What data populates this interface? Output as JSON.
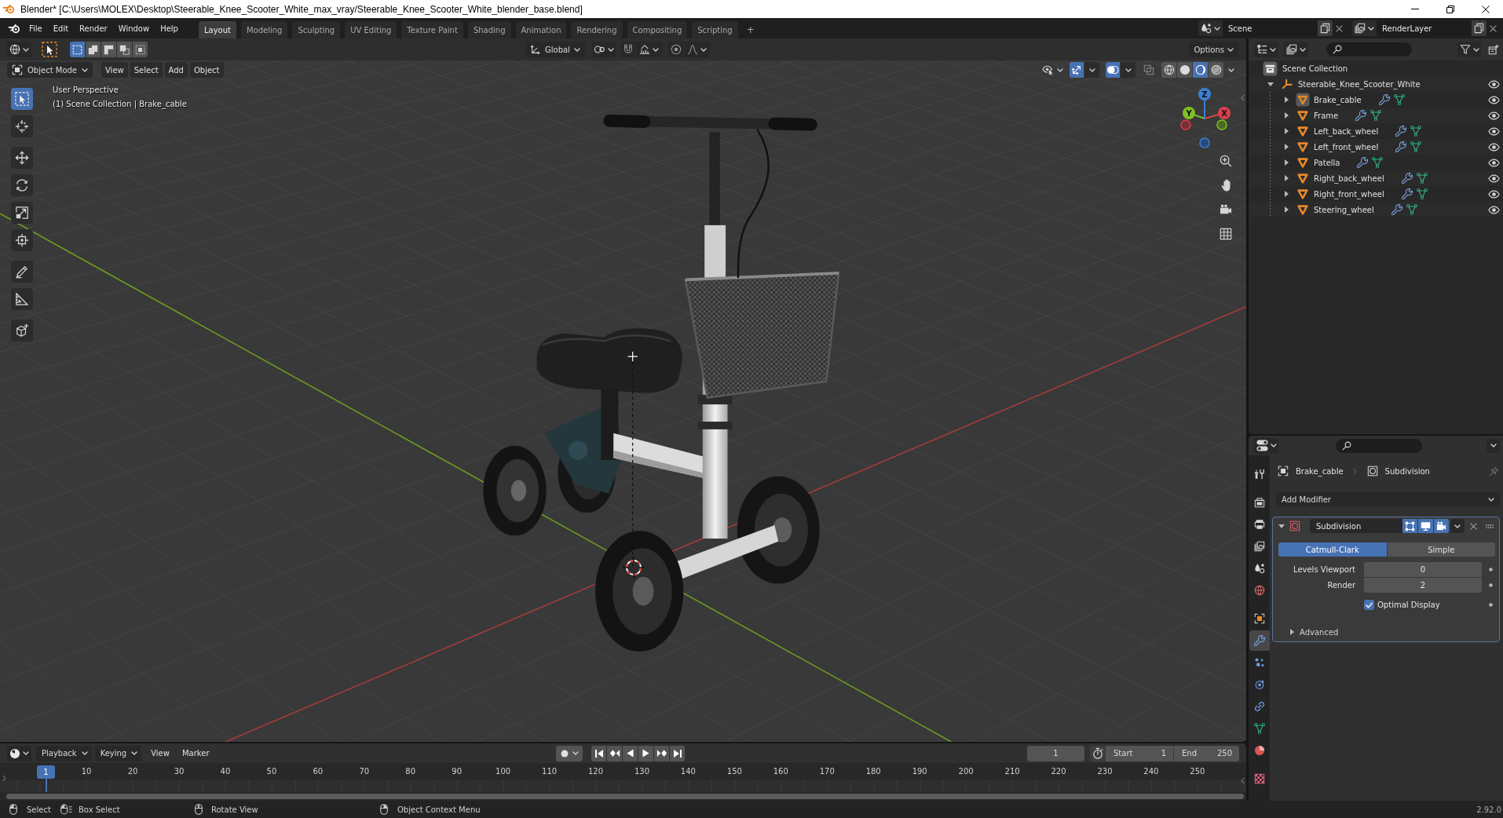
{
  "window": {
    "title": "Blender* [C:\\Users\\MOLEX\\Desktop\\Steerable_Knee_Scooter_White_max_vray/Steerable_Knee_Scooter_White_blender_base.blend]"
  },
  "top_bar": {
    "menu": [
      "File",
      "Edit",
      "Render",
      "Window",
      "Help"
    ],
    "workspaces": [
      {
        "label": "Layout",
        "selected": true
      },
      {
        "label": "Modeling",
        "selected": false
      },
      {
        "label": "Sculpting",
        "selected": false
      },
      {
        "label": "UV Editing",
        "selected": false
      },
      {
        "label": "Texture Paint",
        "selected": false
      },
      {
        "label": "Shading",
        "selected": false
      },
      {
        "label": "Animation",
        "selected": false
      },
      {
        "label": "Rendering",
        "selected": false
      },
      {
        "label": "Compositing",
        "selected": false
      },
      {
        "label": "Scripting",
        "selected": false
      }
    ],
    "add_workspace": "+",
    "scene": "Scene",
    "view_layer": "RenderLayer"
  },
  "tool_header": {
    "select_modes": [
      {
        "kind": "set",
        "selected": true
      },
      {
        "kind": "extend",
        "selected": false
      },
      {
        "kind": "subtract",
        "selected": false
      },
      {
        "kind": "invert",
        "selected": false
      },
      {
        "kind": "intersect",
        "selected": false
      }
    ],
    "orientation": "Global",
    "options": "Options"
  },
  "viewport_header": {
    "mode": "Object Mode",
    "menus": [
      "View",
      "Select",
      "Add",
      "Object"
    ],
    "gizmos": true,
    "overlays": true,
    "xray": false,
    "shading": [
      {
        "kind": "wireframe",
        "selected": false
      },
      {
        "kind": "solid",
        "selected": false
      },
      {
        "kind": "material",
        "selected": true
      },
      {
        "kind": "rendered",
        "selected": false
      }
    ]
  },
  "viewport": {
    "view_name": "User Perspective",
    "context": "(1) Scene Collection | Brake_cable",
    "axes": [
      "X",
      "Y",
      "Z"
    ],
    "toolbar": [
      [
        {
          "kind": "select-box",
          "selected": true
        },
        {
          "kind": "cursor",
          "selected": false
        }
      ],
      [
        {
          "kind": "move",
          "selected": false
        },
        {
          "kind": "rotate",
          "selected": false
        },
        {
          "kind": "scale",
          "selected": false
        },
        {
          "kind": "transform",
          "selected": false
        }
      ],
      [
        {
          "kind": "annotate",
          "selected": false
        },
        {
          "kind": "measure",
          "selected": false
        }
      ],
      [
        {
          "kind": "add-cube",
          "selected": false
        }
      ]
    ]
  },
  "outliner": {
    "root": "Scene Collection",
    "items": [
      {
        "name": "Steerable_Knee_Scooter_White",
        "kind": "empty",
        "expanded": true,
        "active": false,
        "visible": true,
        "children": [
          {
            "name": "Brake_cable",
            "kind": "mesh",
            "expanded": false,
            "active": true,
            "visible": true
          },
          {
            "name": "Frame",
            "kind": "mesh",
            "expanded": false,
            "active": false,
            "visible": true
          },
          {
            "name": "Left_back_wheel",
            "kind": "mesh",
            "expanded": false,
            "active": false,
            "visible": true
          },
          {
            "name": "Left_front_wheel",
            "kind": "mesh",
            "expanded": false,
            "active": false,
            "visible": true
          },
          {
            "name": "Patella",
            "kind": "mesh",
            "expanded": false,
            "active": false,
            "visible": true
          },
          {
            "name": "Right_back_wheel",
            "kind": "mesh",
            "expanded": false,
            "active": false,
            "visible": true
          },
          {
            "name": "Right_front_wheel",
            "kind": "mesh",
            "expanded": false,
            "active": false,
            "visible": true
          },
          {
            "name": "Steering_wheel",
            "kind": "mesh",
            "expanded": false,
            "active": false,
            "visible": true
          }
        ]
      }
    ]
  },
  "properties": {
    "tabs": [
      [
        {
          "kind": "tool",
          "selected": false
        }
      ],
      [
        {
          "kind": "render",
          "selected": false
        },
        {
          "kind": "output",
          "selected": false
        },
        {
          "kind": "view-layer",
          "selected": false
        },
        {
          "kind": "scene",
          "selected": false
        },
        {
          "kind": "world",
          "selected": false
        }
      ],
      [
        {
          "kind": "object",
          "selected": false
        },
        {
          "kind": "modifiers",
          "selected": true
        },
        {
          "kind": "particles",
          "selected": false
        },
        {
          "kind": "physics",
          "selected": false
        },
        {
          "kind": "constraints",
          "selected": false
        },
        {
          "kind": "data",
          "selected": false
        },
        {
          "kind": "material",
          "selected": false
        }
      ],
      [
        {
          "kind": "texture",
          "selected": false
        }
      ]
    ],
    "object": "Brake_cable",
    "modifier": "Subdivision",
    "add_modifier": "Add Modifier",
    "modifiers": [
      {
        "name": "Subdivision",
        "expanded": true,
        "edit_mode": true,
        "in_viewport": true,
        "in_render": true,
        "types": [
          {
            "label": "Catmull-Clark",
            "selected": true
          },
          {
            "label": "Simple",
            "selected": false
          }
        ],
        "fields": [
          {
            "label": "Levels Viewport",
            "value": "0"
          },
          {
            "label": "Render",
            "value": "2"
          }
        ],
        "options": [
          {
            "label": "Optimal Display",
            "checked": true
          }
        ],
        "subpanels": [
          {
            "label": "Advanced",
            "expanded": false
          }
        ]
      }
    ]
  },
  "timeline": {
    "menus": [
      {
        "label": "Playback",
        "kind": "dropdown"
      },
      {
        "label": "Keying",
        "kind": "dropdown"
      },
      {
        "label": "View",
        "kind": "menu"
      },
      {
        "label": "Marker",
        "kind": "menu"
      }
    ],
    "auto_keying": false,
    "current_frame": "1",
    "use_preview_range": false,
    "start_label": "Start",
    "start": "1",
    "end_label": "End",
    "end": "250",
    "playhead": "1",
    "ticks": [
      "10",
      "20",
      "30",
      "40",
      "50",
      "60",
      "70",
      "80",
      "90",
      "100",
      "110",
      "120",
      "130",
      "140",
      "150",
      "160",
      "170",
      "180",
      "190",
      "200",
      "210",
      "220",
      "230",
      "240",
      "250"
    ]
  },
  "status_bar": {
    "hints": [
      {
        "kind": "left-click",
        "label": "Select"
      },
      {
        "kind": "left-drag",
        "label": "Box Select"
      },
      {
        "kind": "middle-click",
        "label": "Rotate View"
      },
      {
        "kind": "right-click",
        "label": "Object Context Menu"
      }
    ],
    "version": "2.92.0"
  }
}
